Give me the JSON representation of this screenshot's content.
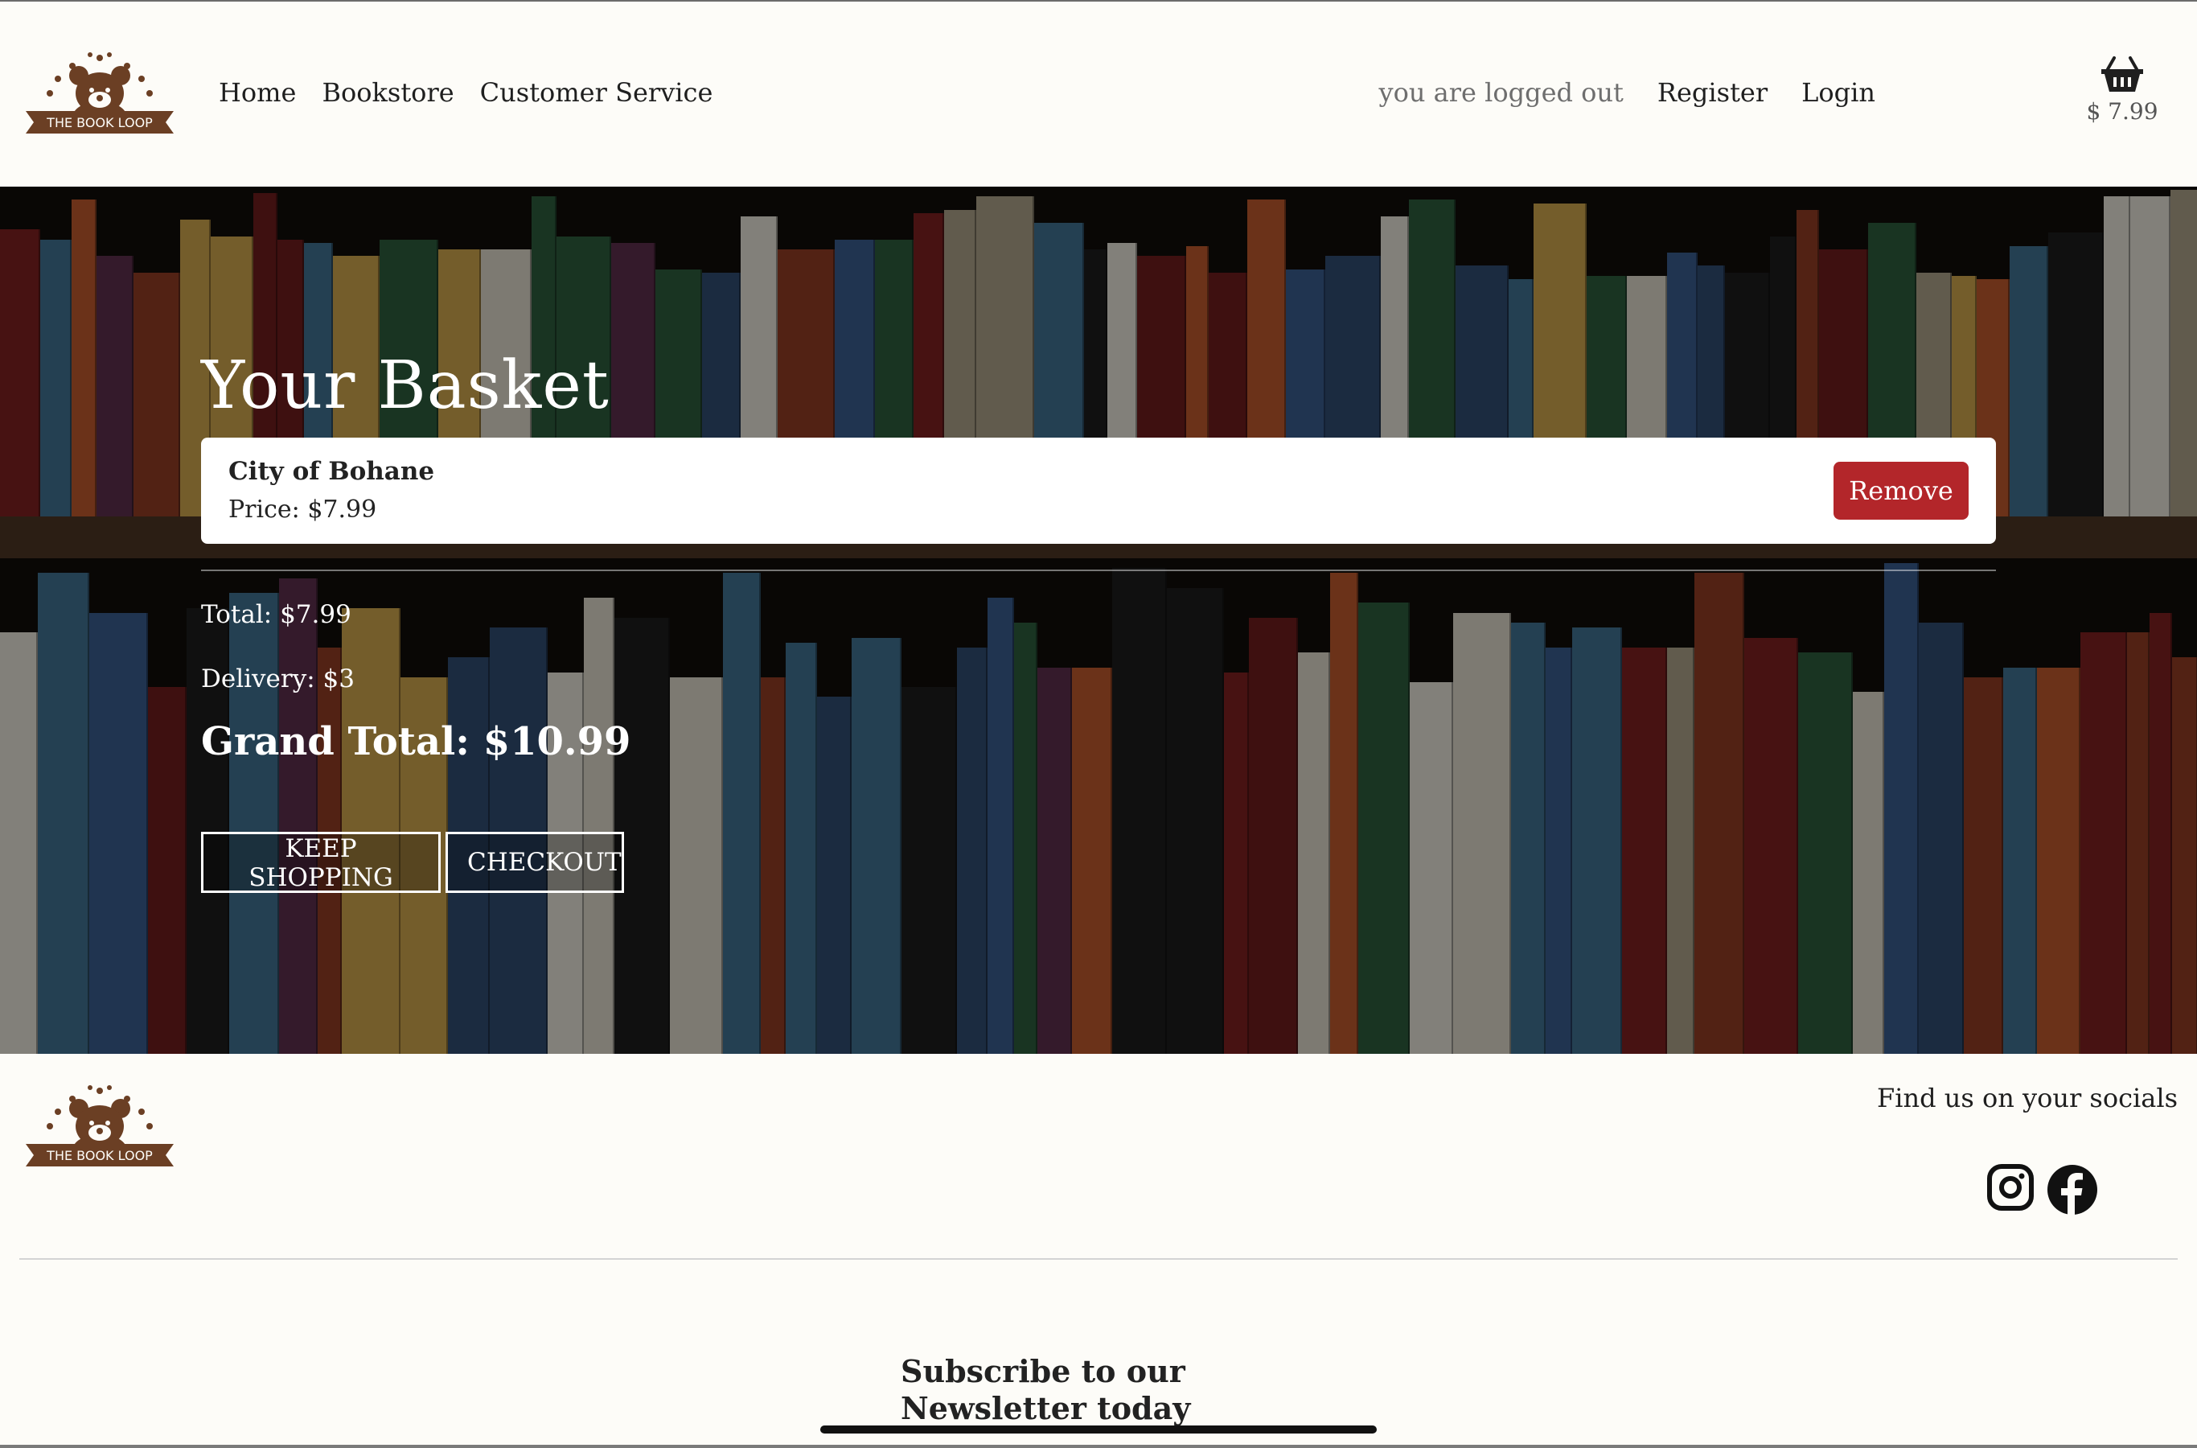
{
  "brand": {
    "logo_text": "THE BOOK LOOP",
    "brown": "#6b3f24"
  },
  "nav": {
    "items": [
      "Home",
      "Bookstore",
      "Customer Service"
    ]
  },
  "auth": {
    "status": "you are logged out",
    "register": "Register",
    "login": "Login"
  },
  "cart": {
    "icon": "basket-icon",
    "amount": "$ 7.99"
  },
  "basket": {
    "title": "Your Basket",
    "item": {
      "title": "City of Bohane",
      "price": "Price: $7.99",
      "remove": "Remove"
    },
    "total": "Total: $7.99",
    "delivery": "Delivery: $3",
    "grand_total": "Grand Total: $10.99",
    "keep_shopping": "KEEP SHOPPING",
    "checkout": "CHECKOUT"
  },
  "footer": {
    "find_us": "Find us on your socials",
    "socials": [
      "instagram-icon",
      "facebook-icon"
    ],
    "newsletter": "Subscribe to our Newsletter today"
  },
  "colors": {
    "accent_red": "#b3262a",
    "background": "#fdfcf8"
  }
}
